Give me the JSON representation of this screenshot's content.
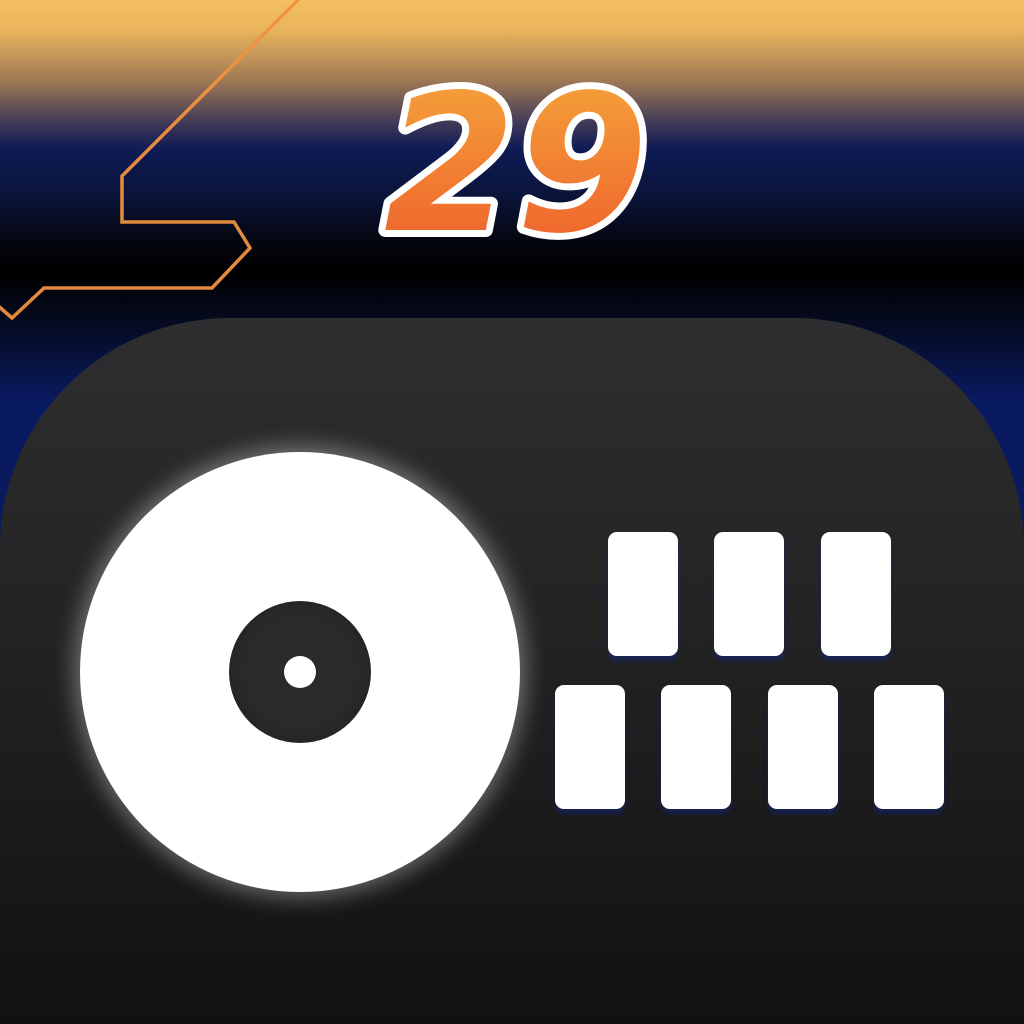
{
  "badge": {
    "version_text": "29",
    "fill_top": "#f5a93c",
    "fill_bottom": "#ee5a2a",
    "outline": "#ffffff"
  },
  "colors": {
    "accent_line": "#f0913f",
    "device_body": "#262627",
    "turntable": "#ffffff",
    "pads": "#ffffff"
  },
  "icons": {
    "turntable": "turntable-icon",
    "pads": "drum-pads-icon"
  }
}
